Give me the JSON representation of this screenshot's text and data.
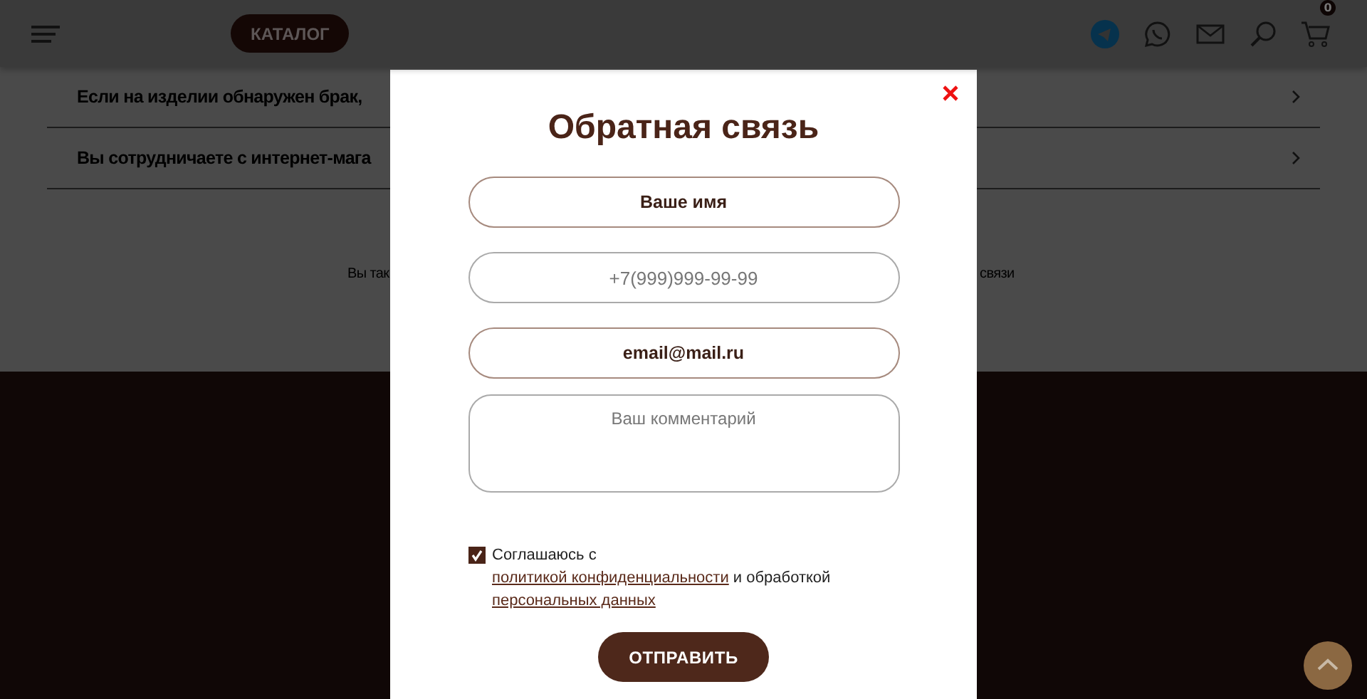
{
  "header": {
    "catalog": "КАТАЛОГ",
    "cart_count": "0"
  },
  "faq": [
    {
      "question": "Если на изделии обнаружен брак,"
    },
    {
      "question": "Вы сотрудничаете с интернет-мага"
    }
  ],
  "contact_note": {
    "left": "Вы так",
    "right": "связи"
  },
  "modal": {
    "title": "Обратная связь",
    "fields": [
      {
        "kind": "input",
        "value": "Ваше имя"
      },
      {
        "kind": "input",
        "placeholder": "+7(999)999-99-99"
      },
      {
        "kind": "input",
        "value": "email@mail.ru"
      },
      {
        "kind": "textarea",
        "placeholder": "Ваш комментарий"
      }
    ],
    "consent": {
      "checked": true,
      "parts": [
        {
          "kind": "text",
          "text": "Соглашаюсь с"
        },
        {
          "kind": "link",
          "text": "политикой конфиденциальности"
        },
        {
          "kind": "text",
          "text": "и обработкой"
        },
        {
          "kind": "link",
          "text": "персональных данных"
        }
      ]
    },
    "submit": "ОТПРАВИТЬ"
  }
}
